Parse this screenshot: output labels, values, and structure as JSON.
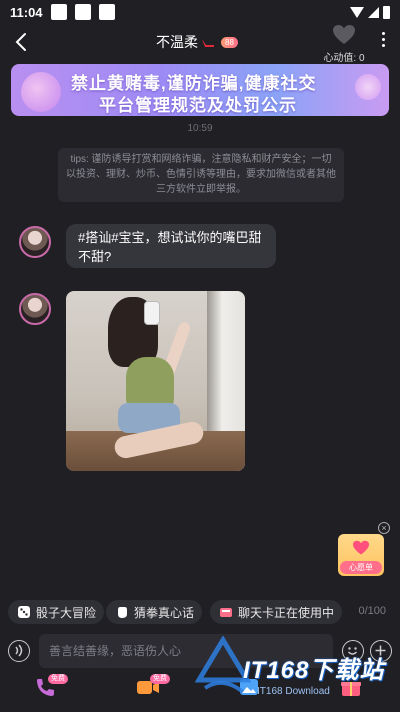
{
  "status_bar": {
    "time": "11:04"
  },
  "header": {
    "title": "不温柔",
    "badge": "88",
    "heart_value": "心动值: 0"
  },
  "banner": {
    "line1": "禁止黄赌毒,谨防诈骗,健康社交",
    "line2": "平台管理规范及处罚公示"
  },
  "chat": {
    "timestamp": "10:59",
    "tips": "tips: 谨防诱导打赏和网络诈骗，注意隐私和财产安全；一切以投资、理财、炒币、色情引诱等理由，要求加微信或者其他三方软件立即举报。",
    "messages": [
      {
        "type": "text",
        "text": "#搭讪#宝宝，想试试你的嘴巴甜不甜?"
      },
      {
        "type": "image"
      }
    ]
  },
  "floating": {
    "label": "心愿单"
  },
  "quick_actions": [
    {
      "label": "骰子大冒险",
      "icon": "dice-icon"
    },
    {
      "label": "猜拳真心话",
      "icon": "fist-icon"
    },
    {
      "label": "聊天卡正在使用中",
      "icon": "chat-card-icon"
    }
  ],
  "input": {
    "placeholder": "善言结善缘，恶语伤人心",
    "value": "",
    "counter": "0/100"
  },
  "bottom_bar": {
    "items": [
      {
        "icon": "phone-call-icon",
        "badge": "免费"
      },
      {
        "icon": "video-call-icon",
        "badge": "免费"
      },
      {
        "icon": "image-icon",
        "badge": ""
      },
      {
        "icon": "gift-icon",
        "badge": ""
      }
    ]
  },
  "watermark": {
    "text": "IT168下载站",
    "sub": "IT168 Download"
  },
  "colors": {
    "background": "#1f1f24",
    "bubble": "#35353c",
    "accent": "#ff6aa0"
  }
}
